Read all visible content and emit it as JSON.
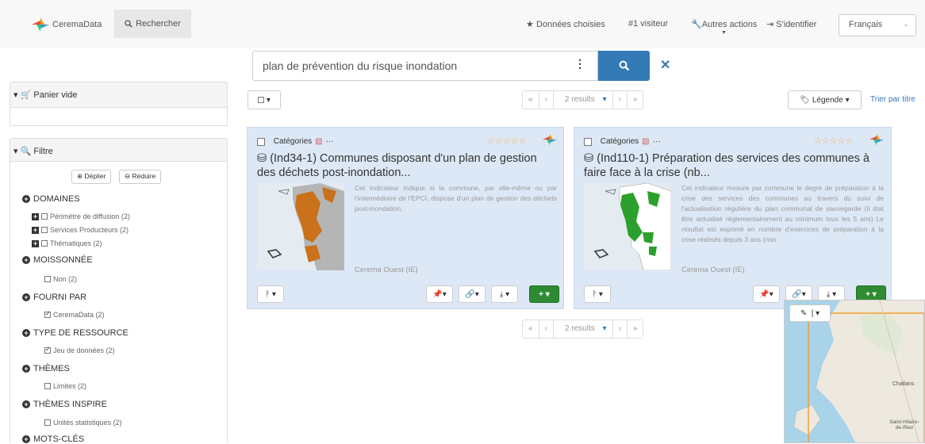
{
  "navbar": {
    "brand": "CeremaData",
    "search_tab": "Rechercher",
    "selected": "Données choisies",
    "visitors": "#1 visiteur",
    "other_actions": "Autres actions",
    "login": "S'identifier",
    "language": "Français"
  },
  "search": {
    "query": "plan de prévention du risque inondation"
  },
  "cart": {
    "title": "Panier vide"
  },
  "filter": {
    "title": "Filtre",
    "expand": "Déplier",
    "collapse": "Réduire",
    "groups": [
      {
        "label": "DOMAINES",
        "items": [
          "Périmètre de diffusion (2)",
          "Services Producteurs (2)",
          "Thématiques (2)"
        ]
      },
      {
        "label": "MOISSONNÉE",
        "items": [
          "Non (2)"
        ]
      },
      {
        "label": "FOURNI PAR",
        "items": [
          "CeremaData (2)"
        ]
      },
      {
        "label": "TYPE DE RESSOURCE",
        "items": [
          "Jeu de données (2)"
        ]
      },
      {
        "label": "THÈMES",
        "items": [
          "Limites (2)"
        ]
      },
      {
        "label": "THÈMES INSPIRE",
        "items": [
          "Unités statistiques (2)"
        ]
      },
      {
        "label": "MOTS-CLÉS",
        "items": []
      }
    ]
  },
  "toolbar": {
    "select_label": "☐",
    "pager_results": "2 results",
    "legend": "Légende",
    "sort": "Trier par titre"
  },
  "results": [
    {
      "category": "Catégories",
      "title": "(Ind34-1) Communes disposant d'un plan de gestion des déchets post-inondation...",
      "description": "Cet indicateur indique si la commune, par elle-même ou par l'intermédiaire de l'EPCI, dispose d'un plan de gestion des déchets post-inondation.",
      "source": "Cerema Ouest (IE)"
    },
    {
      "category": "Catégories",
      "title": "(Ind110-1) Préparation des services des communes à faire face à la crise (nb...",
      "description": "Cet indicateur mesure par commune le degré de préparation à la crise des services des communes au travers du suivi de l'actualisation régulière du plan communal de sauvegarde (il doit être actualisé réglementairement au minimum tous les 5 ans) Le résultat est exprimé en nombre d'exercices de préparation à la crise réalisés depuis 3 ans (non",
      "source": "Cerema Ouest (IE)"
    }
  ],
  "map_labels": {
    "town1": "Challans",
    "town2": "Saint-Hilaire-de-Riez"
  },
  "colors": {
    "primary": "#337ab7",
    "green": "#2e8b32",
    "card_bg": "#dde8f6",
    "orange": "#c9711b"
  }
}
